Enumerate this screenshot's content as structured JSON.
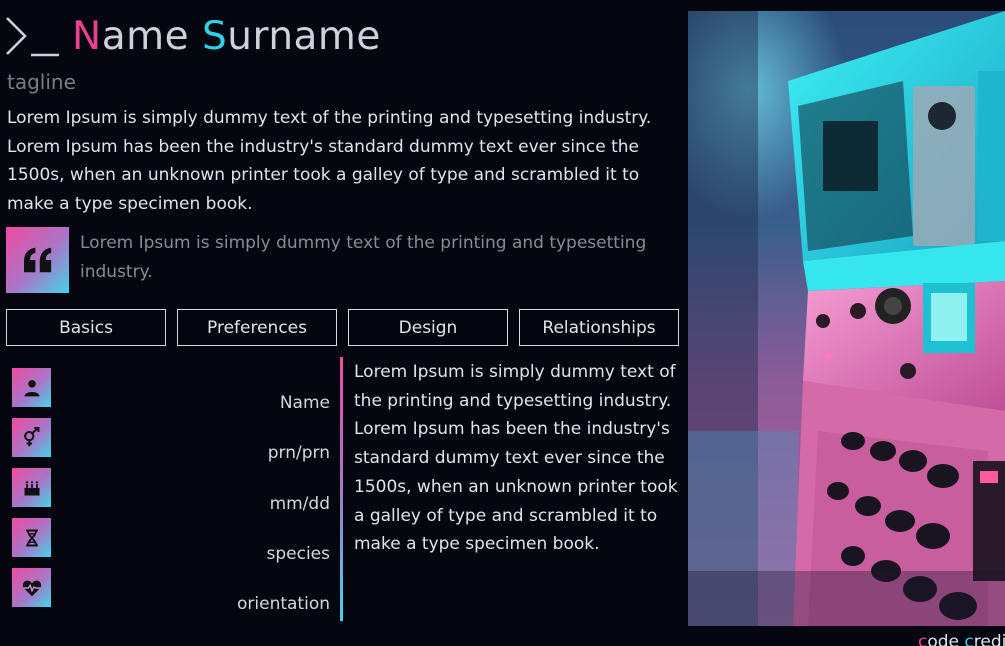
{
  "header": {
    "first_initial": "N",
    "first_rest": "ame",
    "last_initial": "S",
    "last_rest": "urname",
    "prompt_icon": "terminal-prompt-icon"
  },
  "tagline": "tagline",
  "intro": "Lorem Ipsum is simply dummy text of the printing and typesetting industry. Lorem Ipsum has been the industry's standard dummy text ever since the 1500s, when an unknown printer took a galley of type and scrambled it to make a type specimen book.",
  "quote": {
    "icon": "quote-icon",
    "text": "Lorem Ipsum is simply dummy text of the printing and typesetting industry."
  },
  "tabs": [
    "Basics",
    "Preferences",
    "Design",
    "Relationships"
  ],
  "fields": [
    {
      "icon": "person-icon",
      "label": "Name"
    },
    {
      "icon": "gender-icon",
      "label": "prn/prn"
    },
    {
      "icon": "birthday-cake-icon",
      "label": "mm/dd"
    },
    {
      "icon": "dna-icon",
      "label": "species"
    },
    {
      "icon": "heartbeat-icon",
      "label": "orientation"
    }
  ],
  "bio": "Lorem Ipsum is simply dummy text of the printing and typesetting industry. Lorem Ipsum has been the industry's standard dummy text ever since the 1500s, when an unknown printer took a galley of type and scrambled it to make a type specimen book.",
  "credits": {
    "c": "c",
    "ode": "ode ",
    "cr": "c",
    "redi": "redi"
  },
  "colors": {
    "background": "#05060f",
    "pink": "#e8418f",
    "cyan": "#2fd3e6"
  }
}
